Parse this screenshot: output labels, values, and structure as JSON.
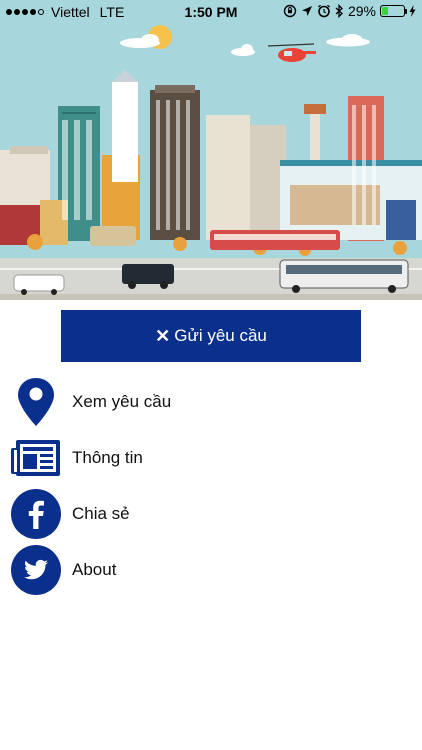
{
  "status_bar": {
    "carrier": "Viettel",
    "network": "LTE",
    "time": "1:50 PM",
    "battery_percent": "29%",
    "battery_level": 0.29
  },
  "main": {
    "send_request_label": "Gửi yêu cầu"
  },
  "menu": {
    "items": [
      {
        "label": "Xem yêu cầu",
        "icon": "location-pin-icon"
      },
      {
        "label": "Thông tin",
        "icon": "newspaper-icon"
      },
      {
        "label": "Chia sẻ",
        "icon": "facebook-icon"
      },
      {
        "label": "About",
        "icon": "twitter-icon"
      }
    ]
  },
  "colors": {
    "brand": "#0b2f8c",
    "sky": "#a8d6dd"
  }
}
